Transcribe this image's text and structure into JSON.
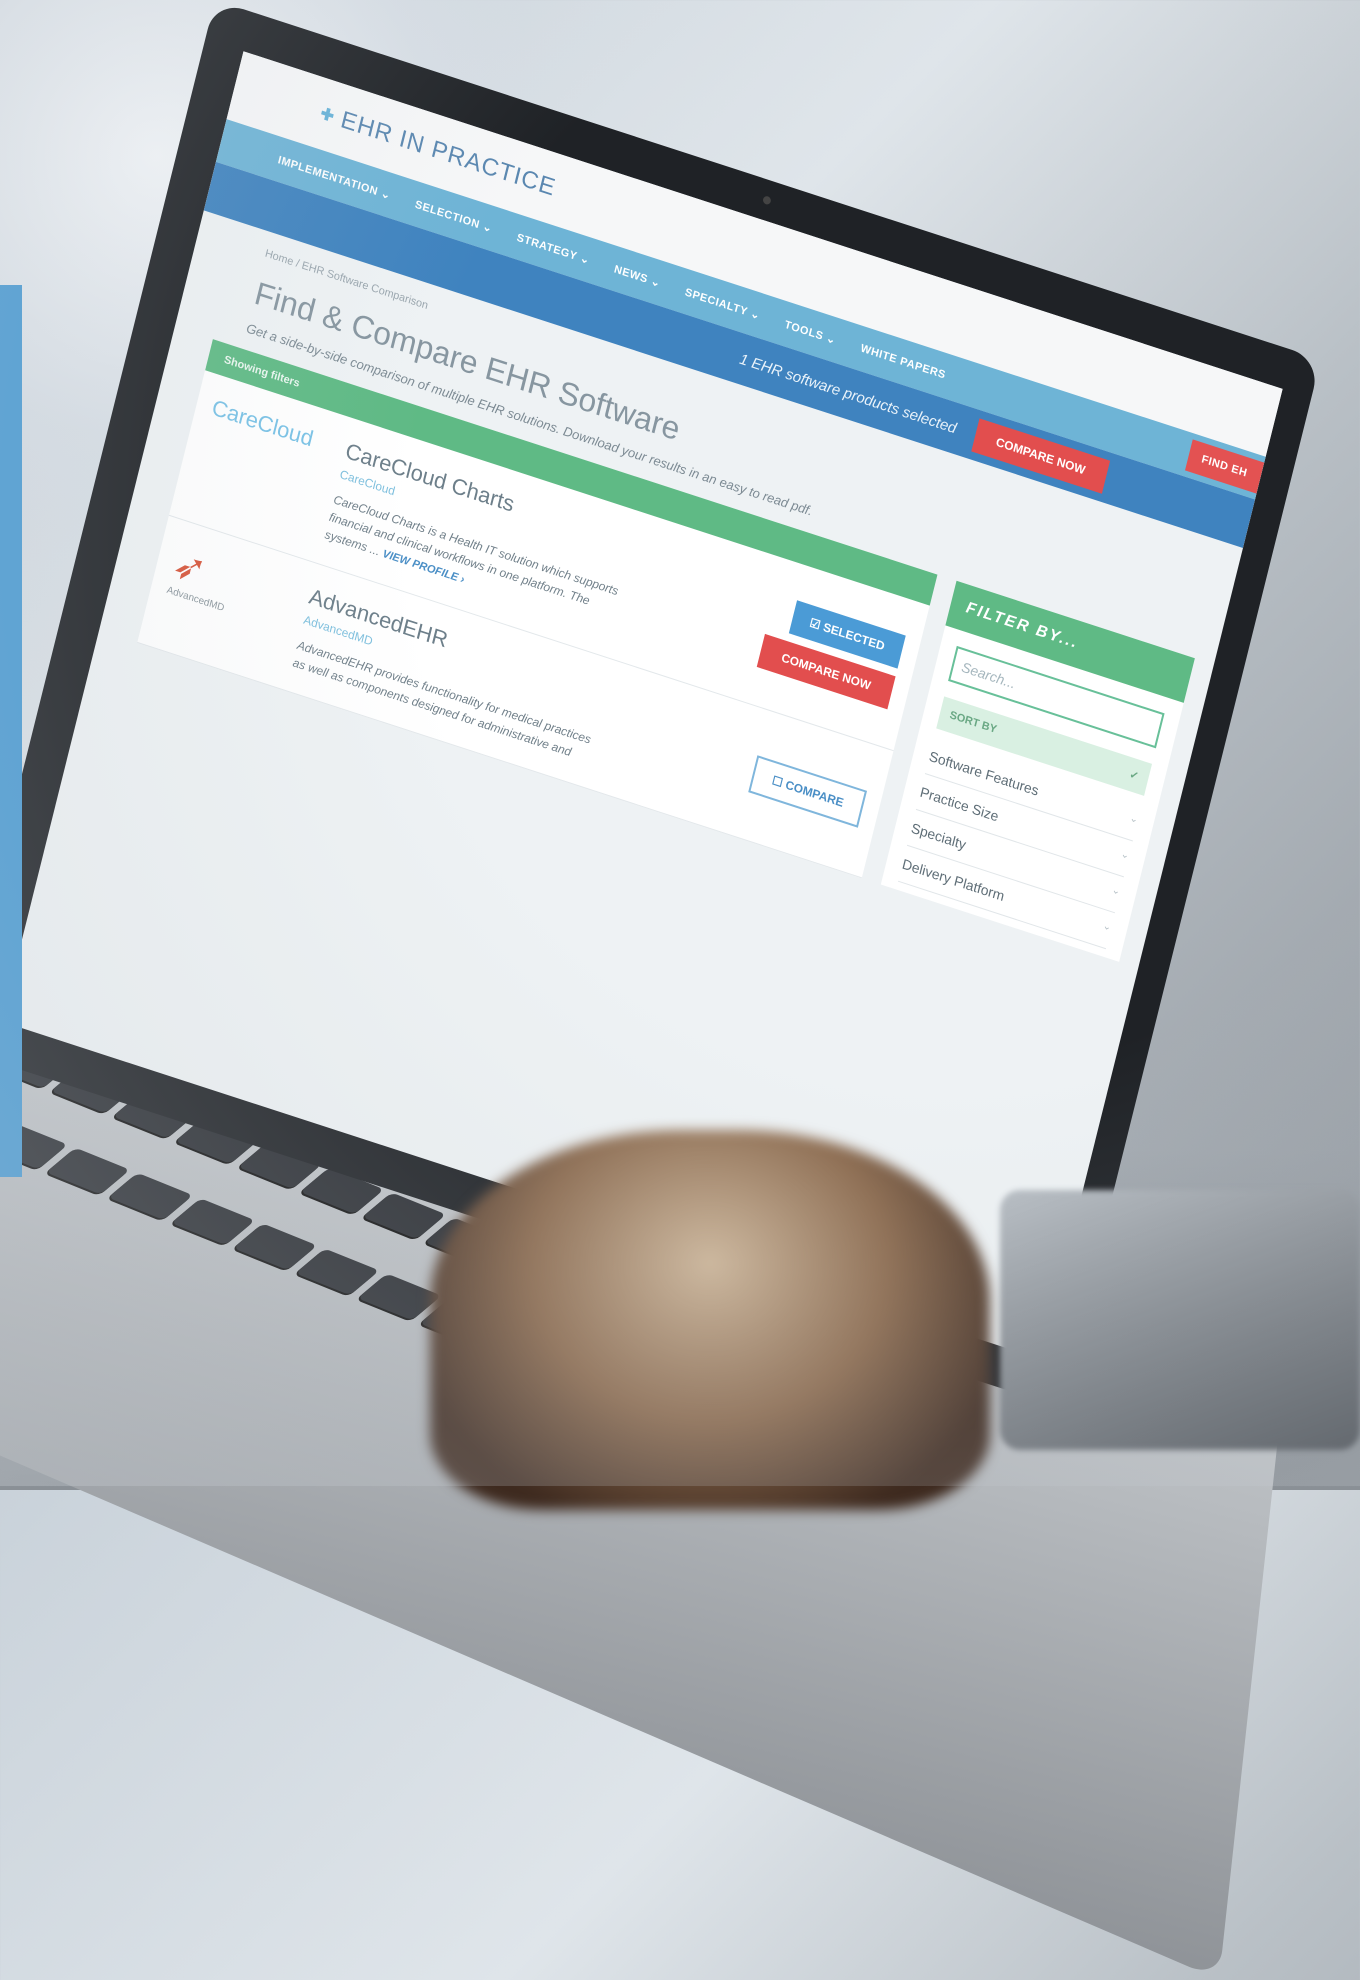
{
  "site": {
    "logo_primary": "EHR",
    "logo_secondary": "IN PRACTICE",
    "logo_mark": "✚"
  },
  "nav": {
    "items": [
      "IMPLEMENTATION ⌄",
      "SELECTION ⌄",
      "STRATEGY ⌄",
      "NEWS ⌄",
      "SPECIALTY ⌄",
      "TOOLS ⌄",
      "WHITE PAPERS"
    ],
    "find_button": "FIND EH"
  },
  "compare_bar": {
    "text": "1 EHR software products selected",
    "button": "COMPARE NOW"
  },
  "breadcrumb": "Home / EHR Software Comparison",
  "page": {
    "title": "Find & Compare EHR Software",
    "subtitle": "Get a side-by-side comparison of multiple EHR solutions. Download your results in an easy to read pdf."
  },
  "results": {
    "header": "Showing filters",
    "cards": [
      {
        "logo": "CareCloud",
        "title": "CareCloud Charts",
        "vendor": "CareCloud",
        "desc": "CareCloud Charts is a Health IT solution which supports financial and clinical workflows in one platform. The systems ...",
        "link": "VIEW PROFILE ›",
        "primary_action": "SELECTED",
        "secondary_action": "COMPARE NOW"
      },
      {
        "logo": "AdvancedMD",
        "title": "AdvancedEHR",
        "vendor": "AdvancedMD",
        "desc": "AdvancedEHR provides functionality for medical practices as well as components designed for administrative and",
        "link": "",
        "primary_action": "COMPARE"
      }
    ]
  },
  "filter": {
    "title": "FILTER BY...",
    "search_placeholder": "Search...",
    "sort_label": "SORT BY",
    "facets": [
      "Software Features",
      "Practice Size",
      "Specialty",
      "Delivery Platform"
    ]
  },
  "colors": {
    "side_bar": "#4a9bd3",
    "nav": "#6eb4d6",
    "compare_bar": "#3f83bf",
    "accent_red": "#e24e4e",
    "accent_green": "#5fba85"
  }
}
